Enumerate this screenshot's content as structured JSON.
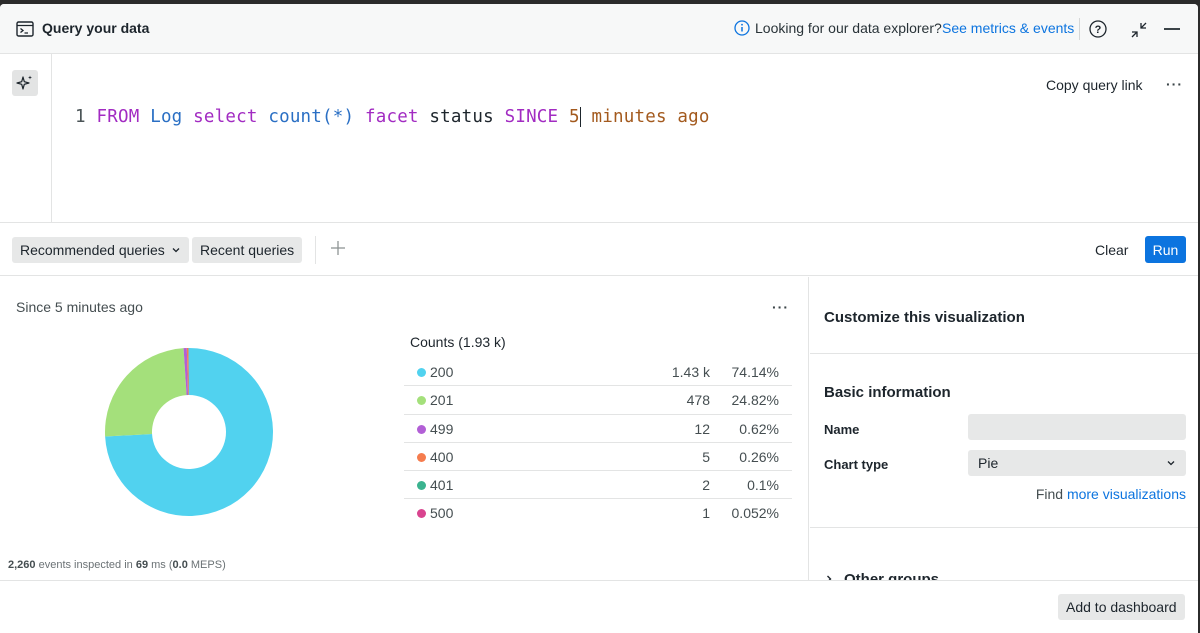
{
  "header": {
    "title": "Query your data",
    "info_text": "Looking for our data explorer?",
    "info_link": "See metrics & events"
  },
  "editor": {
    "line_number": "1",
    "tokens": {
      "from": "FROM",
      "log": "Log",
      "select": "select",
      "count": "count(*)",
      "facet": "facet",
      "status": "status",
      "since": "SINCE",
      "five": "5",
      "minutes_ago": "minutes ago"
    },
    "copy_link": "Copy query link",
    "more": "···"
  },
  "toolbar": {
    "recommended": "Recommended queries",
    "recent": "Recent queries",
    "clear": "Clear",
    "run": "Run"
  },
  "results": {
    "since": "Since 5 minutes ago",
    "more": "···",
    "counts_title": "Counts (1.93 k)",
    "rows": [
      {
        "label": "200",
        "count": "1.43 k",
        "pct": "74.14%",
        "color": "#51d2ef"
      },
      {
        "label": "201",
        "count": "478",
        "pct": "24.82%",
        "color": "#a4e07b"
      },
      {
        "label": "499",
        "count": "12",
        "pct": "0.62%",
        "color": "#b25fd6"
      },
      {
        "label": "400",
        "count": "5",
        "pct": "0.26%",
        "color": "#f57c4e"
      },
      {
        "label": "401",
        "count": "2",
        "pct": "0.1%",
        "color": "#3bb38f"
      },
      {
        "label": "500",
        "count": "1",
        "pct": "0.052%",
        "color": "#d9448f"
      }
    ],
    "stats_events": "2,260",
    "stats_events_text": "events inspected in",
    "stats_ms": "69",
    "stats_ms_text": "ms (",
    "stats_meps": "0.0",
    "stats_meps_text": "MEPS)"
  },
  "chart_data": {
    "type": "pie",
    "categories": [
      "200",
      "201",
      "499",
      "400",
      "401",
      "500"
    ],
    "values": [
      74.14,
      24.82,
      0.62,
      0.26,
      0.1,
      0.052
    ],
    "colors": [
      "#51d2ef",
      "#a4e07b",
      "#b25fd6",
      "#f57c4e",
      "#3bb38f",
      "#d9448f"
    ],
    "title": "Counts (1.93 k)"
  },
  "side": {
    "title": "Customize this visualization",
    "basic": "Basic information",
    "name_label": "Name",
    "name_value": "",
    "chart_type_label": "Chart type",
    "chart_type_value": "Pie",
    "find_text": "Find",
    "find_link": "more visualizations",
    "other_groups": "Other groups"
  },
  "bottom": {
    "add_dashboard": "Add to dashboard"
  }
}
